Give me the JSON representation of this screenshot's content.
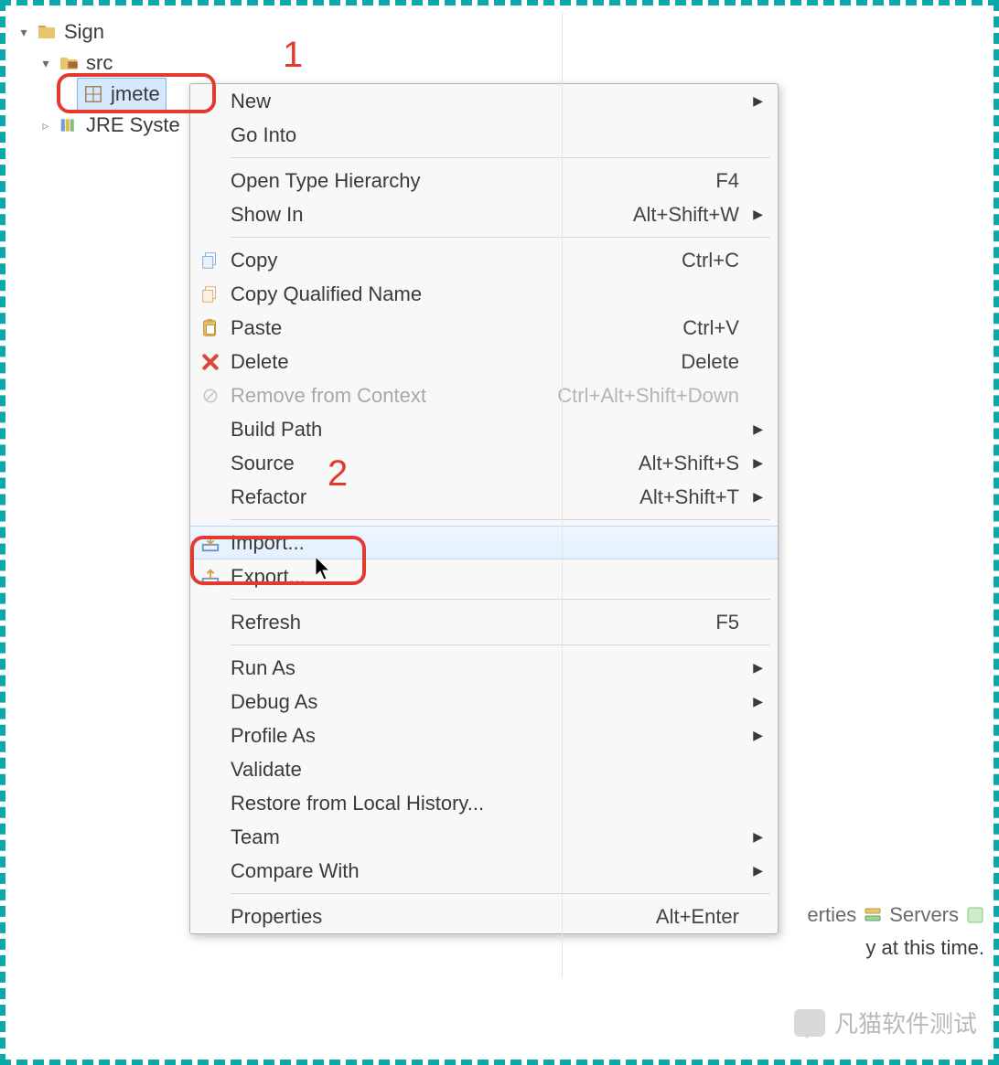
{
  "tree": {
    "root": {
      "label": "Sign",
      "expanded": true
    },
    "src": {
      "label": "src",
      "expanded": true
    },
    "pkg": {
      "label": "jmete",
      "selected": true
    },
    "jre": {
      "label": "JRE Syste",
      "expanded": false
    }
  },
  "annotations": {
    "n1": "1",
    "n2": "2"
  },
  "menu": {
    "new": {
      "label": "New",
      "submenu": true
    },
    "goInto": {
      "label": "Go Into"
    },
    "openType": {
      "label": "Open Type Hierarchy",
      "shortcut": "F4"
    },
    "showIn": {
      "label": "Show In",
      "shortcut": "Alt+Shift+W",
      "submenu": true
    },
    "copy": {
      "label": "Copy",
      "shortcut": "Ctrl+C"
    },
    "copyQ": {
      "label": "Copy Qualified Name"
    },
    "paste": {
      "label": "Paste",
      "shortcut": "Ctrl+V"
    },
    "delete": {
      "label": "Delete",
      "shortcut": "Delete"
    },
    "removeCtx": {
      "label": "Remove from Context",
      "shortcut": "Ctrl+Alt+Shift+Down",
      "disabled": true
    },
    "buildPath": {
      "label": "Build Path",
      "submenu": true
    },
    "source": {
      "label": "Source",
      "shortcut": "Alt+Shift+S",
      "submenu": true
    },
    "refactor": {
      "label": "Refactor",
      "shortcut": "Alt+Shift+T",
      "submenu": true
    },
    "import": {
      "label": "Import...",
      "hover": true
    },
    "export": {
      "label": "Export..."
    },
    "refresh": {
      "label": "Refresh",
      "shortcut": "F5"
    },
    "runAs": {
      "label": "Run As",
      "submenu": true
    },
    "debugAs": {
      "label": "Debug As",
      "submenu": true
    },
    "profileAs": {
      "label": "Profile As",
      "submenu": true
    },
    "validate": {
      "label": "Validate"
    },
    "restoreHist": {
      "label": "Restore from Local History..."
    },
    "team": {
      "label": "Team",
      "submenu": true
    },
    "compare": {
      "label": "Compare With",
      "submenu": true
    },
    "properties": {
      "label": "Properties",
      "shortcut": "Alt+Enter"
    }
  },
  "bottom": {
    "tabs_fragment": "erties",
    "servers_tab": "Servers",
    "status_fragment": "y at this time."
  },
  "watermark": {
    "text": "凡猫软件测试"
  }
}
